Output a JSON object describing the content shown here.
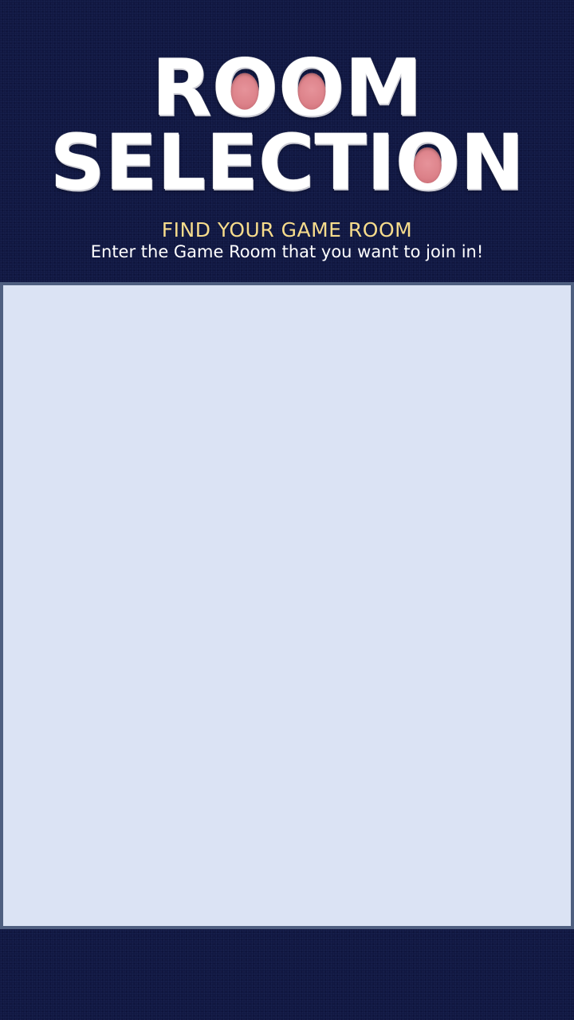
{
  "header": {
    "title_line_1": "ROOM",
    "title_line_2": "SELECTION",
    "subtitle": "FIND YOUR GAME ROOM",
    "instruction": "Enter the Game Room that you want to join in!"
  },
  "colors": {
    "background": "#0f1640",
    "title_text": "#ffffff",
    "title_dots": "#dc8189",
    "subtitle_text": "#f7dc8c",
    "instruction_text": "#ffffff",
    "panel_fill": "#dbe3f4",
    "panel_border": "#4f5f80"
  },
  "room_panel": {
    "rooms": []
  }
}
